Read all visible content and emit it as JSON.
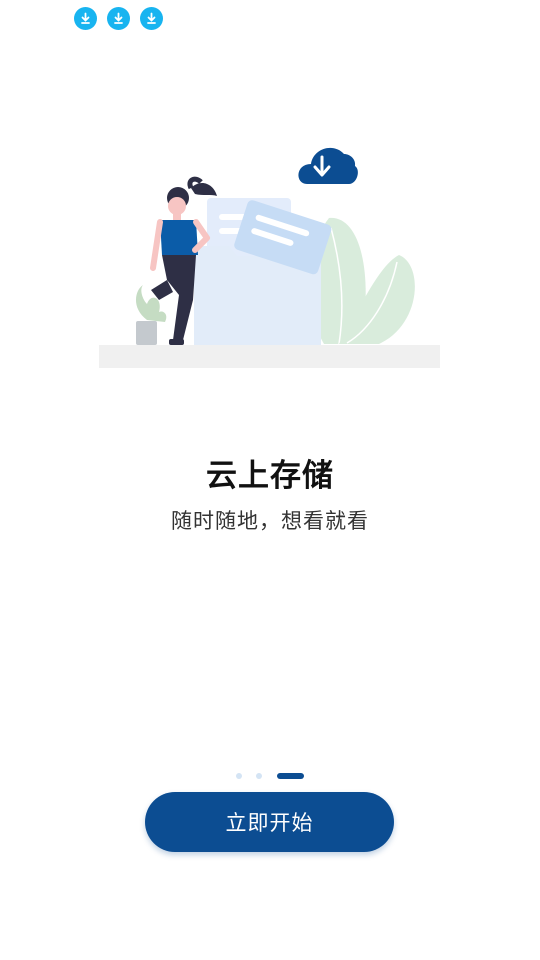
{
  "status_bar": {
    "notification_icons": [
      "download-icon",
      "download-icon",
      "download-icon"
    ]
  },
  "colors": {
    "primary": "#0c4d92",
    "notification": "#18b4f0",
    "dot_inactive": "#d4e4f4",
    "dot_active": "#0c4d92"
  },
  "illustration": {
    "icon": "cloud-download-icon"
  },
  "onboarding": {
    "title": "云上存储",
    "subtitle": "随时随地，想看就看",
    "page_count": 3,
    "current_page": 3
  },
  "actions": {
    "start_label": "立即开始"
  }
}
